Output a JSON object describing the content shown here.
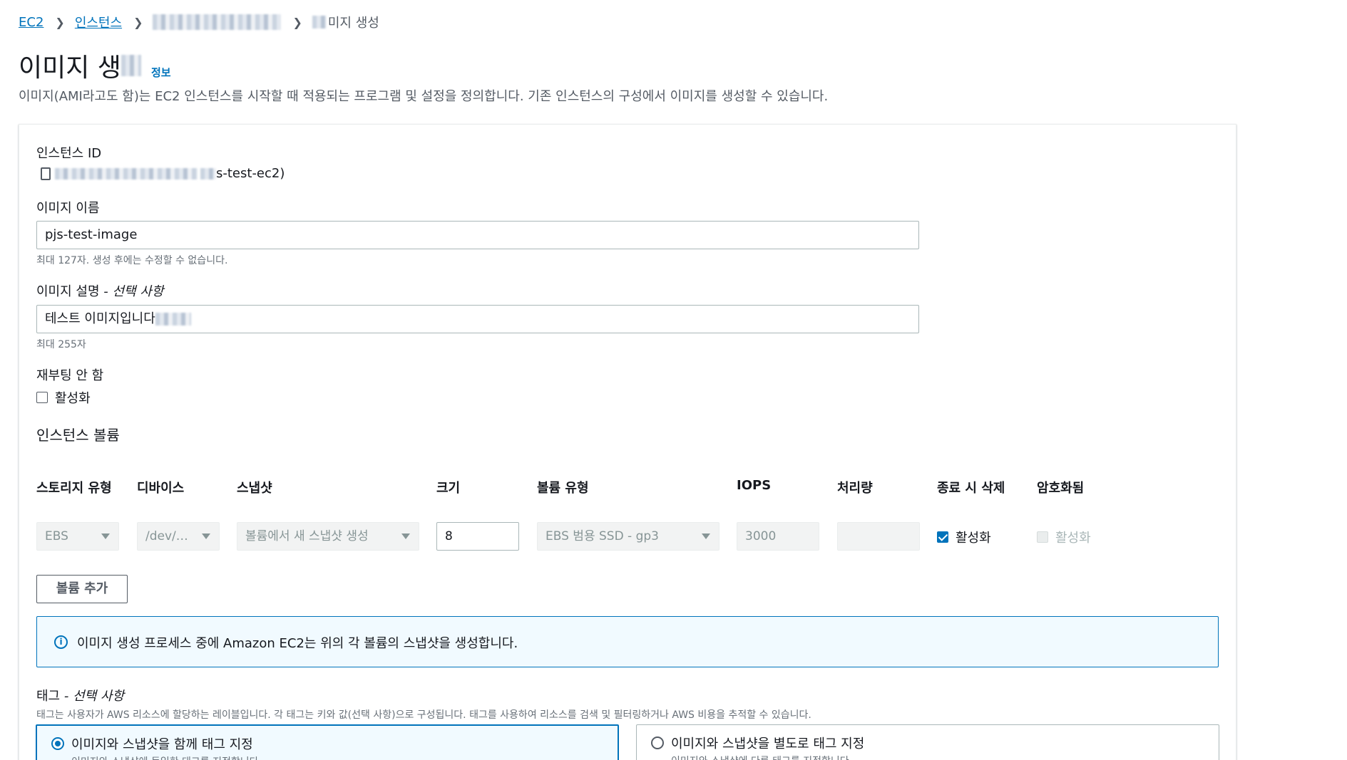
{
  "breadcrumb": {
    "root": "EC2",
    "instances": "인스턴스",
    "current": "미지 생성"
  },
  "header": {
    "title": "이미지 생",
    "info_link": "정보",
    "description": "이미지(AMI라고도 함)는 EC2 인스턴스를 시작할 때 적용되는 프로그램 및 설정을 정의합니다. 기존 인스턴스의 구성에서 이미지를 생성할 수 있습니다."
  },
  "instance": {
    "label": "인스턴스 ID",
    "value_suffix": "s-test-ec2)"
  },
  "image_name": {
    "label": "이미지 이름",
    "value": "pjs-test-image",
    "hint": "최대 127자. 생성 후에는 수정할 수 없습니다."
  },
  "image_desc": {
    "label": "이미지 설명",
    "optional": " - 선택 사항",
    "value": "테스트 이미지입니다",
    "hint": "최대 255자"
  },
  "no_reboot": {
    "label": "재부팅 안 함",
    "checkbox_label": "활성화",
    "checked": false
  },
  "volumes": {
    "section_title": "인스턴스 볼륨",
    "headers": {
      "storage": "스토리지 유형",
      "device": "디바이스",
      "snapshot": "스냅샷",
      "size": "크기",
      "volume_type": "볼륨 유형",
      "iops": "IOPS",
      "throughput": "처리량",
      "delete": "종료 시 삭제",
      "encrypted": "암호화됨"
    },
    "row": {
      "storage": "EBS",
      "device": "/dev/…",
      "snapshot": "볼륨에서 새 스냅샷 생성",
      "size": "8",
      "volume_type": "EBS 범용 SSD - gp3",
      "iops": "3000",
      "throughput": "",
      "delete_label": "활성화",
      "delete_checked": true,
      "encrypted_label": "활성화",
      "encrypted_checked": false
    },
    "add_button": "볼륨 추가"
  },
  "alert": {
    "icon": "info-icon",
    "text": "이미지 생성 프로세스 중에 Amazon EC2는 위의 각 볼륨의 스냅샷을 생성합니다."
  },
  "tags": {
    "label": "태그",
    "optional": " - 선택 사항",
    "description": "태그는 사용자가 AWS 리소스에 할당하는 레이블입니다. 각 태그는 키와 값(선택 사항)으로 구성됩니다. 태그를 사용하여 리소스를 검색 및 필터링하거나 AWS 비용을 추적할 수 있습니다.",
    "option_together": {
      "title": "이미지와 스냅샷을 함께 태그 지정",
      "sub": "이미지와 스냅샷에 동일한 태그를 지정합니다."
    },
    "option_separate": {
      "title": "이미지와 스냅샷을 별도로 태그 지정",
      "sub": "이미지와 스냅샷에 다른 태그를 지정합니다."
    }
  },
  "colors": {
    "link": "#0073bb",
    "text": "#16191f",
    "muted": "#687078"
  }
}
